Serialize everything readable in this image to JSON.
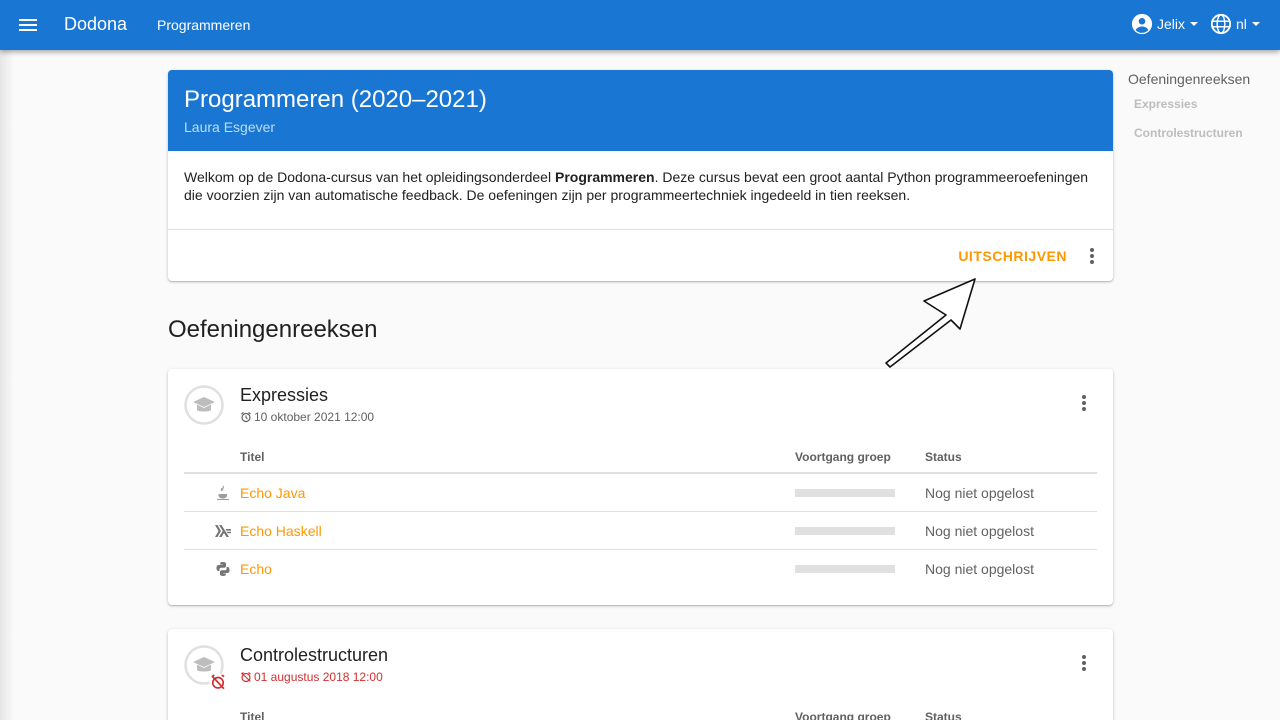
{
  "topbar": {
    "brand": "Dodona",
    "course_link": "Programmeren",
    "user_name": "Jelix",
    "language": "nl",
    "icons": {
      "menu": "hamburger-menu-icon",
      "user": "account-circle-icon",
      "lang": "globe-icon"
    }
  },
  "course": {
    "title": "Programmeren (2020–2021)",
    "teacher": "Laura Esgever",
    "description_pre": "Welkom op de Dodona-cursus van het opleidingsonderdeel ",
    "description_bold": "Programmeren",
    "description_post": ". Deze cursus bevat een groot aantal Python programmeeroefeningen die voorzien zijn van automatische feedback. De oefeningen zijn per programmeertechniek ingedeeld in tien reeksen.",
    "unsubscribe_label": "UITSCHRIJVEN"
  },
  "section_title": "Oefeningenreeksen",
  "toc": {
    "title": "Oefeningenreeksen",
    "items": [
      "Expressies",
      "Controlestructuren"
    ]
  },
  "table_headers": {
    "title": "Titel",
    "progress": "Voortgang groep",
    "status": "Status"
  },
  "series": [
    {
      "name": "Expressies",
      "deadline": "10 oktober 2021 12:00",
      "overdue": false,
      "exercises": [
        {
          "name": "Echo Java",
          "icon": "java-icon",
          "progress": 0,
          "status": "Nog niet opgelost"
        },
        {
          "name": "Echo Haskell",
          "icon": "haskell-icon",
          "progress": 0,
          "status": "Nog niet opgelost"
        },
        {
          "name": "Echo",
          "icon": "python-icon",
          "progress": 0,
          "status": "Nog niet opgelost"
        }
      ]
    },
    {
      "name": "Controlestructuren",
      "deadline": "01 augustus 2018 12:00",
      "overdue": true,
      "exercises": []
    }
  ],
  "colors": {
    "primary": "#1976d2",
    "accent": "#ff9800",
    "overdue": "#d32f2f"
  }
}
